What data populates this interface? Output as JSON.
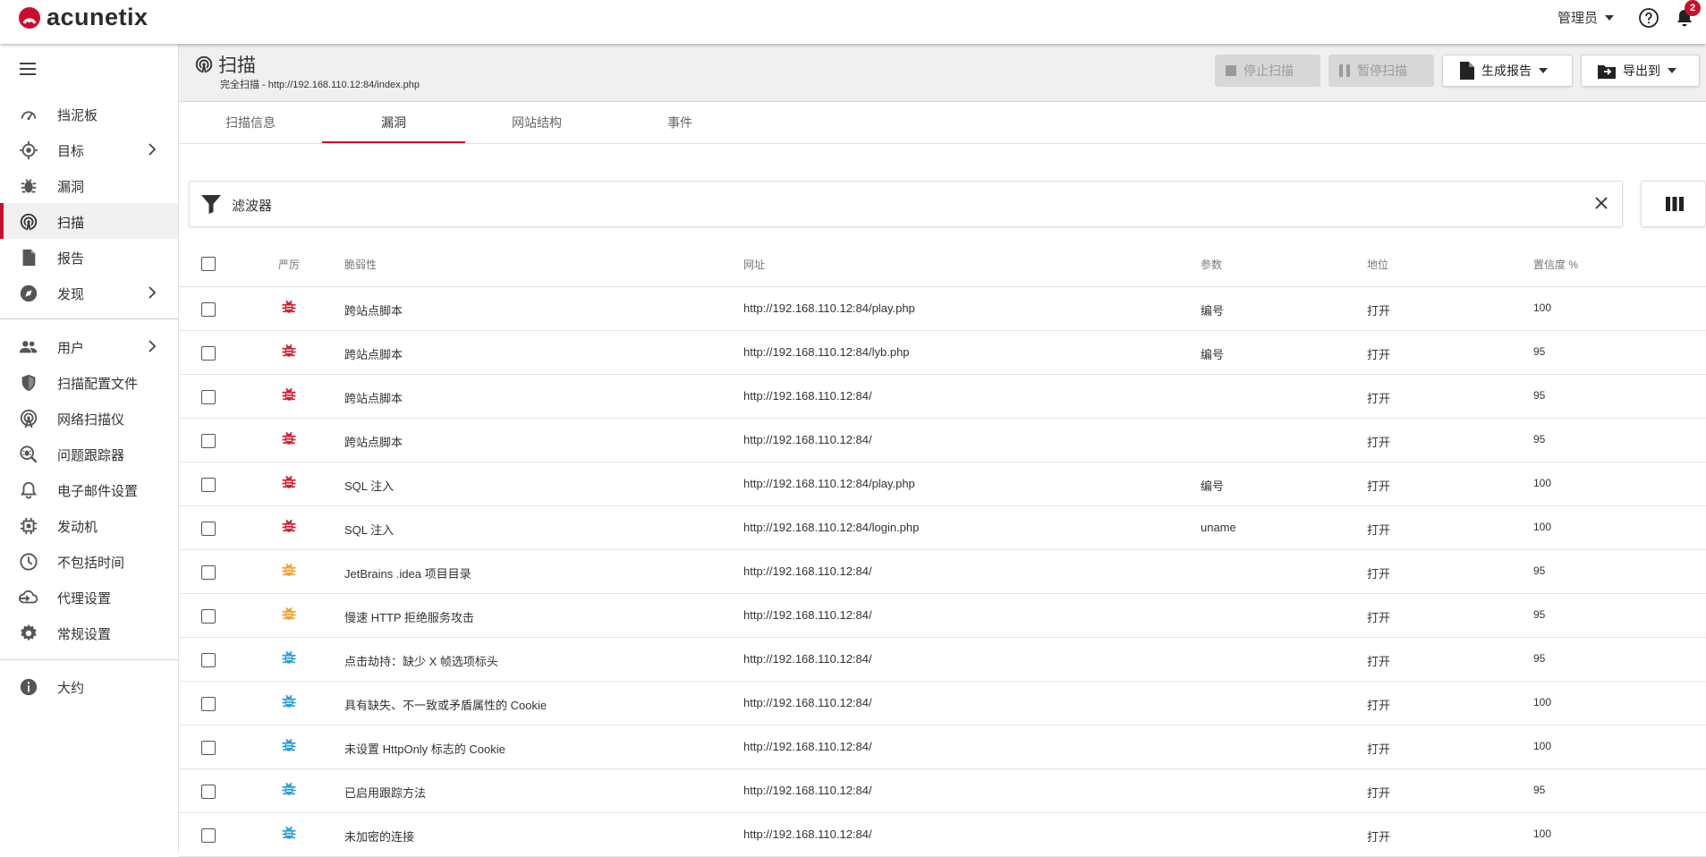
{
  "app": {
    "logo_text": "acunetix",
    "user_menu_label": "管理员",
    "notification_count": "2",
    "brand_color": "#c8102e"
  },
  "sidebar": {
    "items": [
      {
        "label": "挡泥板",
        "icon": "dashboard-icon"
      },
      {
        "label": "目标",
        "icon": "target-icon",
        "arrow": true
      },
      {
        "label": "漏洞",
        "icon": "bug-icon"
      },
      {
        "label": "扫描",
        "icon": "scan-icon",
        "active": true
      },
      {
        "label": "报告",
        "icon": "report-icon"
      },
      {
        "label": "发现",
        "icon": "compass-icon",
        "arrow": true
      },
      {
        "label": "用户",
        "icon": "users-icon",
        "arrow": true
      },
      {
        "label": "扫描配置文件",
        "icon": "shield-icon"
      },
      {
        "label": "网络扫描仪",
        "icon": "network-scanner-icon"
      },
      {
        "label": "问题跟踪器",
        "icon": "issue-tracker-icon"
      },
      {
        "label": "电子邮件设置",
        "icon": "bell-icon"
      },
      {
        "label": "发动机",
        "icon": "engine-icon"
      },
      {
        "label": "不包括时间",
        "icon": "clock-icon"
      },
      {
        "label": "代理设置",
        "icon": "proxy-icon"
      },
      {
        "label": "常规设置",
        "icon": "gear-icon"
      },
      {
        "label": "大约",
        "icon": "info-icon"
      }
    ]
  },
  "header": {
    "title": "扫描",
    "subtitle": "完全扫描 - http://192.168.110.12:84/index.php",
    "buttons": {
      "stop": "停止扫描",
      "pause": "暂停扫描",
      "generate_report": "生成报告",
      "export": "导出到"
    }
  },
  "tabs": [
    {
      "label": "扫描信息"
    },
    {
      "label": "漏洞",
      "active": true
    },
    {
      "label": "网站结构"
    },
    {
      "label": "事件"
    }
  ],
  "filter": {
    "label": "滤波器"
  },
  "table": {
    "columns": [
      "严厉",
      "脆弱性",
      "网址",
      "参数",
      "地位",
      "置信度 %"
    ],
    "rows": [
      {
        "severity": "high",
        "vulnerability": "跨站点脚本",
        "url": "http://192.168.110.12:84/play.php",
        "param": "编号",
        "status": "打开",
        "confidence": "100"
      },
      {
        "severity": "high",
        "vulnerability": "跨站点脚本",
        "url": "http://192.168.110.12:84/lyb.php",
        "param": "编号",
        "status": "打开",
        "confidence": "95"
      },
      {
        "severity": "high",
        "vulnerability": "跨站点脚本",
        "url": "http://192.168.110.12:84/",
        "param": "",
        "status": "打开",
        "confidence": "95"
      },
      {
        "severity": "high",
        "vulnerability": "跨站点脚本",
        "url": "http://192.168.110.12:84/",
        "param": "",
        "status": "打开",
        "confidence": "95"
      },
      {
        "severity": "high",
        "vulnerability": "SQL 注入",
        "url": "http://192.168.110.12:84/play.php",
        "param": "编号",
        "status": "打开",
        "confidence": "100"
      },
      {
        "severity": "high",
        "vulnerability": "SQL 注入",
        "url": "http://192.168.110.12:84/login.php",
        "param": "uname",
        "status": "打开",
        "confidence": "100"
      },
      {
        "severity": "medium",
        "vulnerability": "JetBrains .idea 项目目录",
        "url": "http://192.168.110.12:84/",
        "param": "",
        "status": "打开",
        "confidence": "95"
      },
      {
        "severity": "medium",
        "vulnerability": "慢速 HTTP 拒绝服务攻击",
        "url": "http://192.168.110.12:84/",
        "param": "",
        "status": "打开",
        "confidence": "95"
      },
      {
        "severity": "low",
        "vulnerability": "点击劫持：缺少 X 帧选项标头",
        "url": "http://192.168.110.12:84/",
        "param": "",
        "status": "打开",
        "confidence": "95"
      },
      {
        "severity": "low",
        "vulnerability": "具有缺失、不一致或矛盾属性的 Cookie",
        "url": "http://192.168.110.12:84/",
        "param": "",
        "status": "打开",
        "confidence": "100"
      },
      {
        "severity": "low",
        "vulnerability": "未设置 HttpOnly 标志的 Cookie",
        "url": "http://192.168.110.12:84/",
        "param": "",
        "status": "打开",
        "confidence": "100"
      },
      {
        "severity": "low",
        "vulnerability": "已启用跟踪方法",
        "url": "http://192.168.110.12:84/",
        "param": "",
        "status": "打开",
        "confidence": "95"
      },
      {
        "severity": "low",
        "vulnerability": "未加密的连接",
        "url": "http://192.168.110.12:84/",
        "param": "",
        "status": "打开",
        "confidence": "100"
      }
    ],
    "severity_colors": {
      "high": "#d0202e",
      "medium": "#f0a030",
      "low": "#2a9fd6"
    }
  }
}
